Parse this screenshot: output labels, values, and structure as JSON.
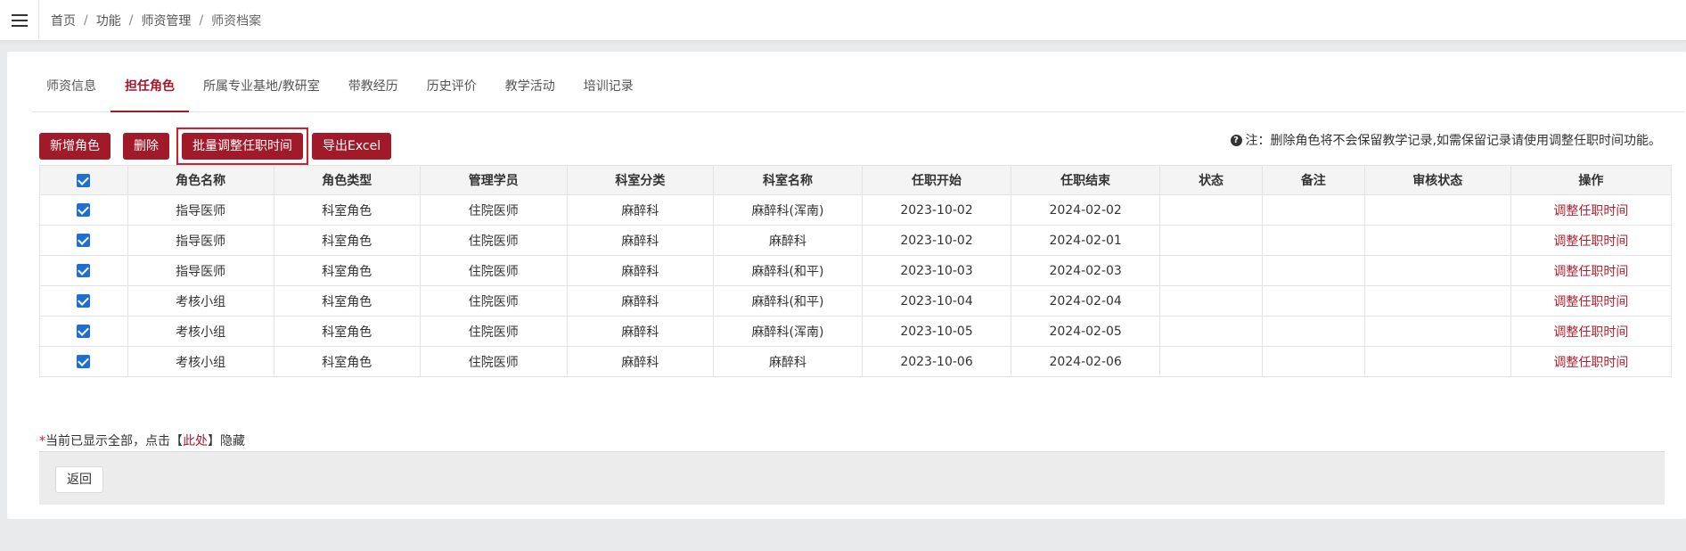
{
  "breadcrumb": [
    "首页",
    "功能",
    "师资管理",
    "师资档案"
  ],
  "tabs": [
    {
      "label": "师资信息",
      "active": false
    },
    {
      "label": "担任角色",
      "active": true
    },
    {
      "label": "所属专业基地/教研室",
      "active": false
    },
    {
      "label": "带教经历",
      "active": false
    },
    {
      "label": "历史评价",
      "active": false
    },
    {
      "label": "教学活动",
      "active": false
    },
    {
      "label": "培训记录",
      "active": false
    }
  ],
  "toolbar": {
    "add_role": "新增角色",
    "delete": "删除",
    "batch_adjust": "批量调整任职时间",
    "export": "导出Excel"
  },
  "note": "注：删除角色将不会保留教学记录,如需保留记录请使用调整任职时间功能。",
  "table": {
    "headers": [
      "角色名称",
      "角色类型",
      "管理学员",
      "科室分类",
      "科室名称",
      "任职开始",
      "任职结束",
      "状态",
      "备注",
      "审核状态",
      "操作"
    ],
    "rows": [
      {
        "checked": true,
        "role": "指导医师",
        "type": "科室角色",
        "students": "住院医师",
        "dept_cat": "麻醉科",
        "dept": "麻醉科(浑南)",
        "start": "2023-10-02",
        "end": "2024-02-02",
        "status": "",
        "remark": "",
        "audit": "",
        "action": "调整任职时间"
      },
      {
        "checked": true,
        "role": "指导医师",
        "type": "科室角色",
        "students": "住院医师",
        "dept_cat": "麻醉科",
        "dept": "麻醉科",
        "start": "2023-10-02",
        "end": "2024-02-01",
        "status": "",
        "remark": "",
        "audit": "",
        "action": "调整任职时间"
      },
      {
        "checked": true,
        "role": "指导医师",
        "type": "科室角色",
        "students": "住院医师",
        "dept_cat": "麻醉科",
        "dept": "麻醉科(和平)",
        "start": "2023-10-03",
        "end": "2024-02-03",
        "status": "",
        "remark": "",
        "audit": "",
        "action": "调整任职时间"
      },
      {
        "checked": true,
        "role": "考核小组",
        "type": "科室角色",
        "students": "住院医师",
        "dept_cat": "麻醉科",
        "dept": "麻醉科(和平)",
        "start": "2023-10-04",
        "end": "2024-02-04",
        "status": "",
        "remark": "",
        "audit": "",
        "action": "调整任职时间"
      },
      {
        "checked": true,
        "role": "考核小组",
        "type": "科室角色",
        "students": "住院医师",
        "dept_cat": "麻醉科",
        "dept": "麻醉科(浑南)",
        "start": "2023-10-05",
        "end": "2024-02-05",
        "status": "",
        "remark": "",
        "audit": "",
        "action": "调整任职时间"
      },
      {
        "checked": true,
        "role": "考核小组",
        "type": "科室角色",
        "students": "住院医师",
        "dept_cat": "麻醉科",
        "dept": "麻醉科",
        "start": "2023-10-06",
        "end": "2024-02-06",
        "status": "",
        "remark": "",
        "audit": "",
        "action": "调整任职时间"
      }
    ]
  },
  "footnote": {
    "required_mark": "*",
    "prefix": "当前已显示全部，点击【",
    "link": "此处",
    "suffix": "】隐藏"
  },
  "back_button": "返回",
  "colors": {
    "accent": "#a11a2a",
    "highlight_border": "#d81e2c",
    "checkbox": "#1f6fd1"
  }
}
